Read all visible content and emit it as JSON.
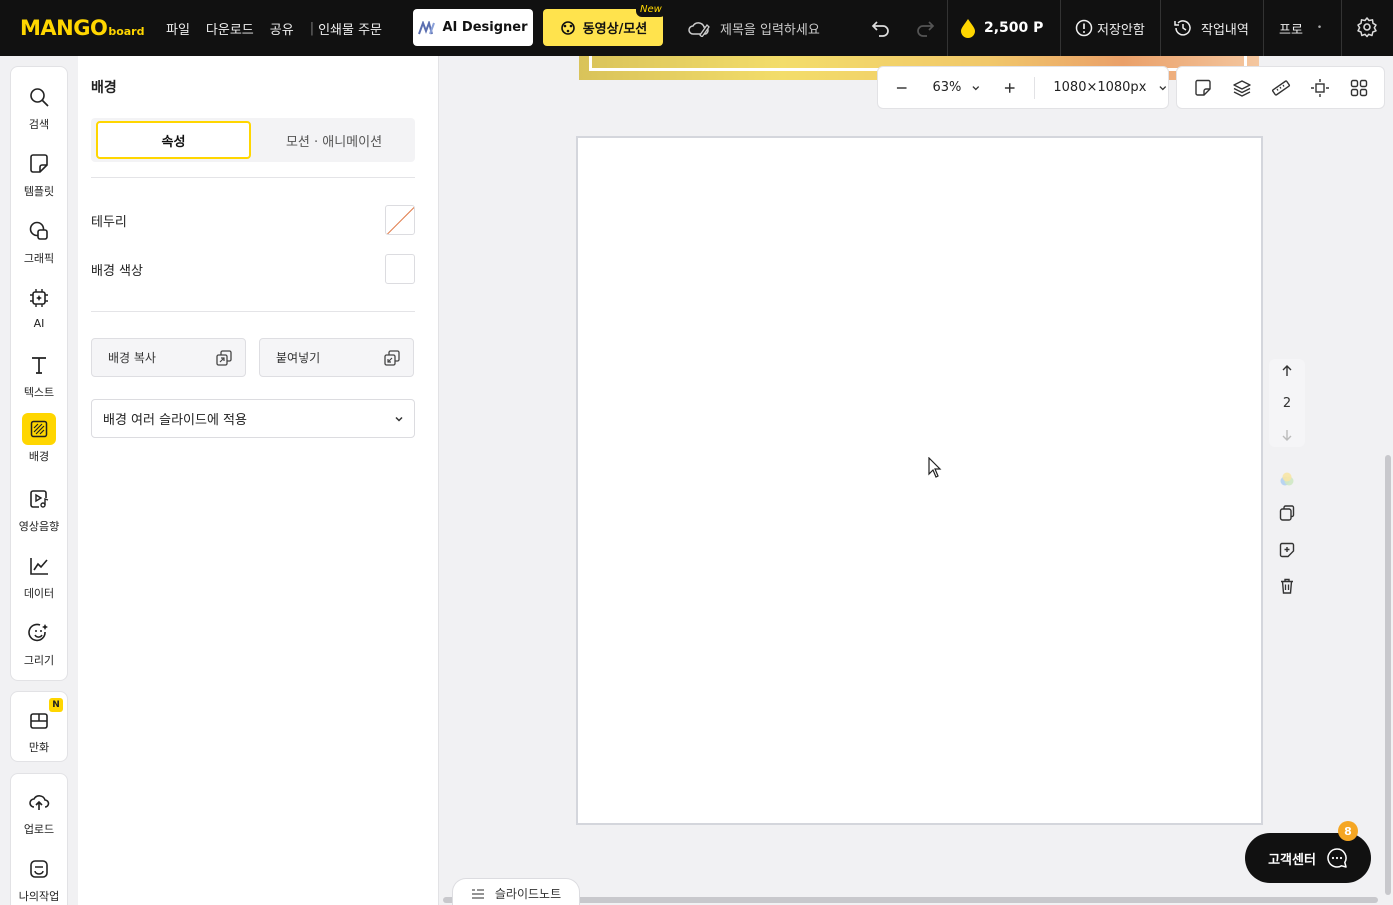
{
  "app": {
    "logo_big": "MANGO",
    "logo_small": "board",
    "menu": [
      "파일",
      "다운로드",
      "공유",
      "인쇄물 주문"
    ],
    "ai_designer_label": "AI Designer",
    "video_motion_label": "동영상/모션",
    "new_badge": "New",
    "title_placeholder": "제목을 입력하세요",
    "points": "2,500 P",
    "save_status": "저장안함",
    "history_label": "작업내역",
    "pro_label": "프로",
    "accent_color": "#ffd600"
  },
  "rail": {
    "items": [
      {
        "label": "검색",
        "icon": "search-icon"
      },
      {
        "label": "템플릿",
        "icon": "template-icon"
      },
      {
        "label": "그래픽",
        "icon": "graphic-icon"
      },
      {
        "label": "AI",
        "icon": "ai-chip-icon"
      },
      {
        "label": "텍스트",
        "icon": "text-icon"
      },
      {
        "label": "배경",
        "icon": "background-icon"
      },
      {
        "label": "영상음향",
        "icon": "video-audio-icon"
      },
      {
        "label": "데이터",
        "icon": "chart-icon"
      },
      {
        "label": "그리기",
        "icon": "draw-icon"
      }
    ],
    "comic": {
      "label": "만화",
      "badge": "N"
    },
    "upload": {
      "label": "업로드"
    },
    "my_work": {
      "label": "나의작업"
    }
  },
  "panel": {
    "title": "배경",
    "tabs": [
      "속성",
      "모션 · 애니메이션"
    ],
    "border_label": "테두리",
    "bg_color_label": "배경 색상",
    "copy_bg_label": "배경 복사",
    "paste_label": "붙여넣기",
    "apply_select": "배경 여러 슬라이드에 적용"
  },
  "canvas": {
    "zoom": "63%",
    "size": "1080×1080px",
    "page_number": "2",
    "slide_note_label": "슬라이드노트",
    "help_label": "고객센터",
    "help_badge": "8"
  }
}
